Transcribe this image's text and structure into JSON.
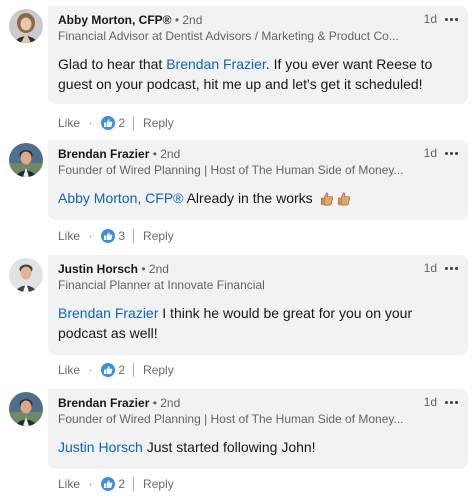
{
  "comments": [
    {
      "author": "Abby Morton, CFP®",
      "degree": "• 2nd",
      "headline": "Financial Advisor at Dentist Advisors / Marketing & Product Co...",
      "time": "1d",
      "text_prefix": "Glad to hear that ",
      "mention": "Brendan Frazier",
      "text_suffix": ". If you ever want Reese to guest on your podcast, hit me up and let's get it scheduled!",
      "like_label": "Like",
      "like_count": "2",
      "reply_label": "Reply"
    },
    {
      "author": "Brendan Frazier",
      "degree": "• 2nd",
      "headline": "Founder of Wired Planning | Host of The Human Side of Money...",
      "time": "1d",
      "text_prefix": "",
      "mention": "Abby Morton, CFP®",
      "text_suffix": " Already in the works",
      "emoji": [
        "thumbs-up-icon",
        "thumbs-up-icon"
      ],
      "like_label": "Like",
      "like_count": "3",
      "reply_label": "Reply"
    },
    {
      "author": "Justin Horsch",
      "degree": "• 2nd",
      "headline": "Financial Planner at Innovate Financial",
      "time": "1d",
      "text_prefix": "",
      "mention": "Brendan Frazier",
      "text_suffix": " I think he would be great for you on your podcast as well!",
      "like_label": "Like",
      "like_count": "2",
      "reply_label": "Reply"
    },
    {
      "author": "Brendan Frazier",
      "degree": "• 2nd",
      "headline": "Founder of Wired Planning | Host of The Human Side of Money...",
      "time": "1d",
      "text_prefix": "",
      "mention": "Justin Horsch",
      "text_suffix": " Just started following John!",
      "like_label": "Like",
      "like_count": "2",
      "reply_label": "Reply"
    }
  ],
  "colors": {
    "bubble": "#f2f2f2",
    "mention": "#0a66c2",
    "like_reaction": "#378fe9"
  },
  "icons": {
    "menu": "more-horizontal-icon",
    "reaction": "like-reaction-icon",
    "avatar": "avatar"
  }
}
